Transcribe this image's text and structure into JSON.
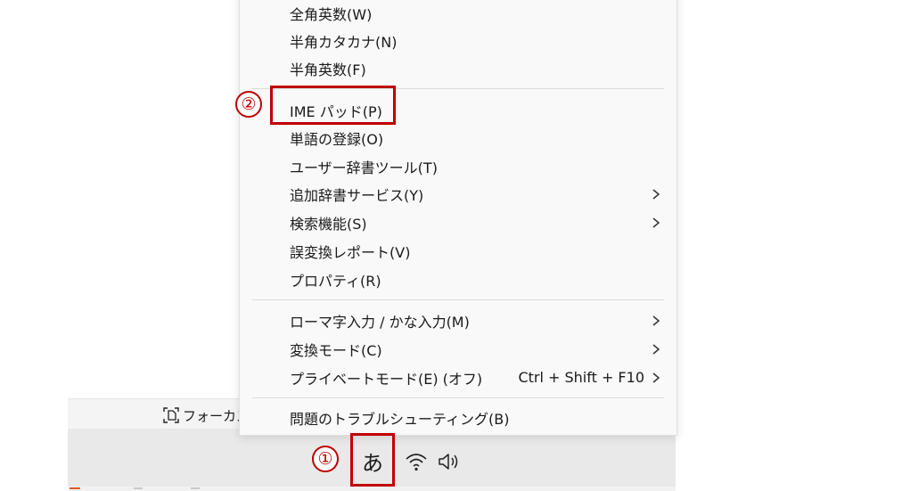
{
  "colors": {
    "accent_callout": "#c00000",
    "menu_bg": "#f9f9f9",
    "taskbar_bg": "#e9e9e9"
  },
  "background": {
    "focus_button_label": "フォーカス"
  },
  "menu": {
    "items": [
      {
        "label": "全角英数(W)",
        "submenu": false
      },
      {
        "label": "半角カタカナ(N)",
        "submenu": false
      },
      {
        "label": "半角英数(F)",
        "submenu": false
      },
      {
        "label": "IME パッド(P)",
        "submenu": false
      },
      {
        "label": "単語の登録(O)",
        "submenu": false
      },
      {
        "label": "ユーザー辞書ツール(T)",
        "submenu": false
      },
      {
        "label": "追加辞書サービス(Y)",
        "submenu": true
      },
      {
        "label": "検索機能(S)",
        "submenu": true
      },
      {
        "label": "誤変換レポート(V)",
        "submenu": false
      },
      {
        "label": "プロパティ(R)",
        "submenu": false
      },
      {
        "label": "ローマ字入力 / かな入力(M)",
        "submenu": true
      },
      {
        "label": "変換モード(C)",
        "submenu": true
      },
      {
        "label": "プライベートモード(E) (オフ)",
        "shortcut": "Ctrl + Shift + F10",
        "submenu": true
      },
      {
        "label": "問題のトラブルシューティング(B)",
        "submenu": false
      }
    ]
  },
  "callouts": {
    "one": "①",
    "two": "②"
  },
  "taskbar": {
    "ime_mode": "あ",
    "icons": [
      "wifi-icon",
      "speaker-icon"
    ]
  }
}
